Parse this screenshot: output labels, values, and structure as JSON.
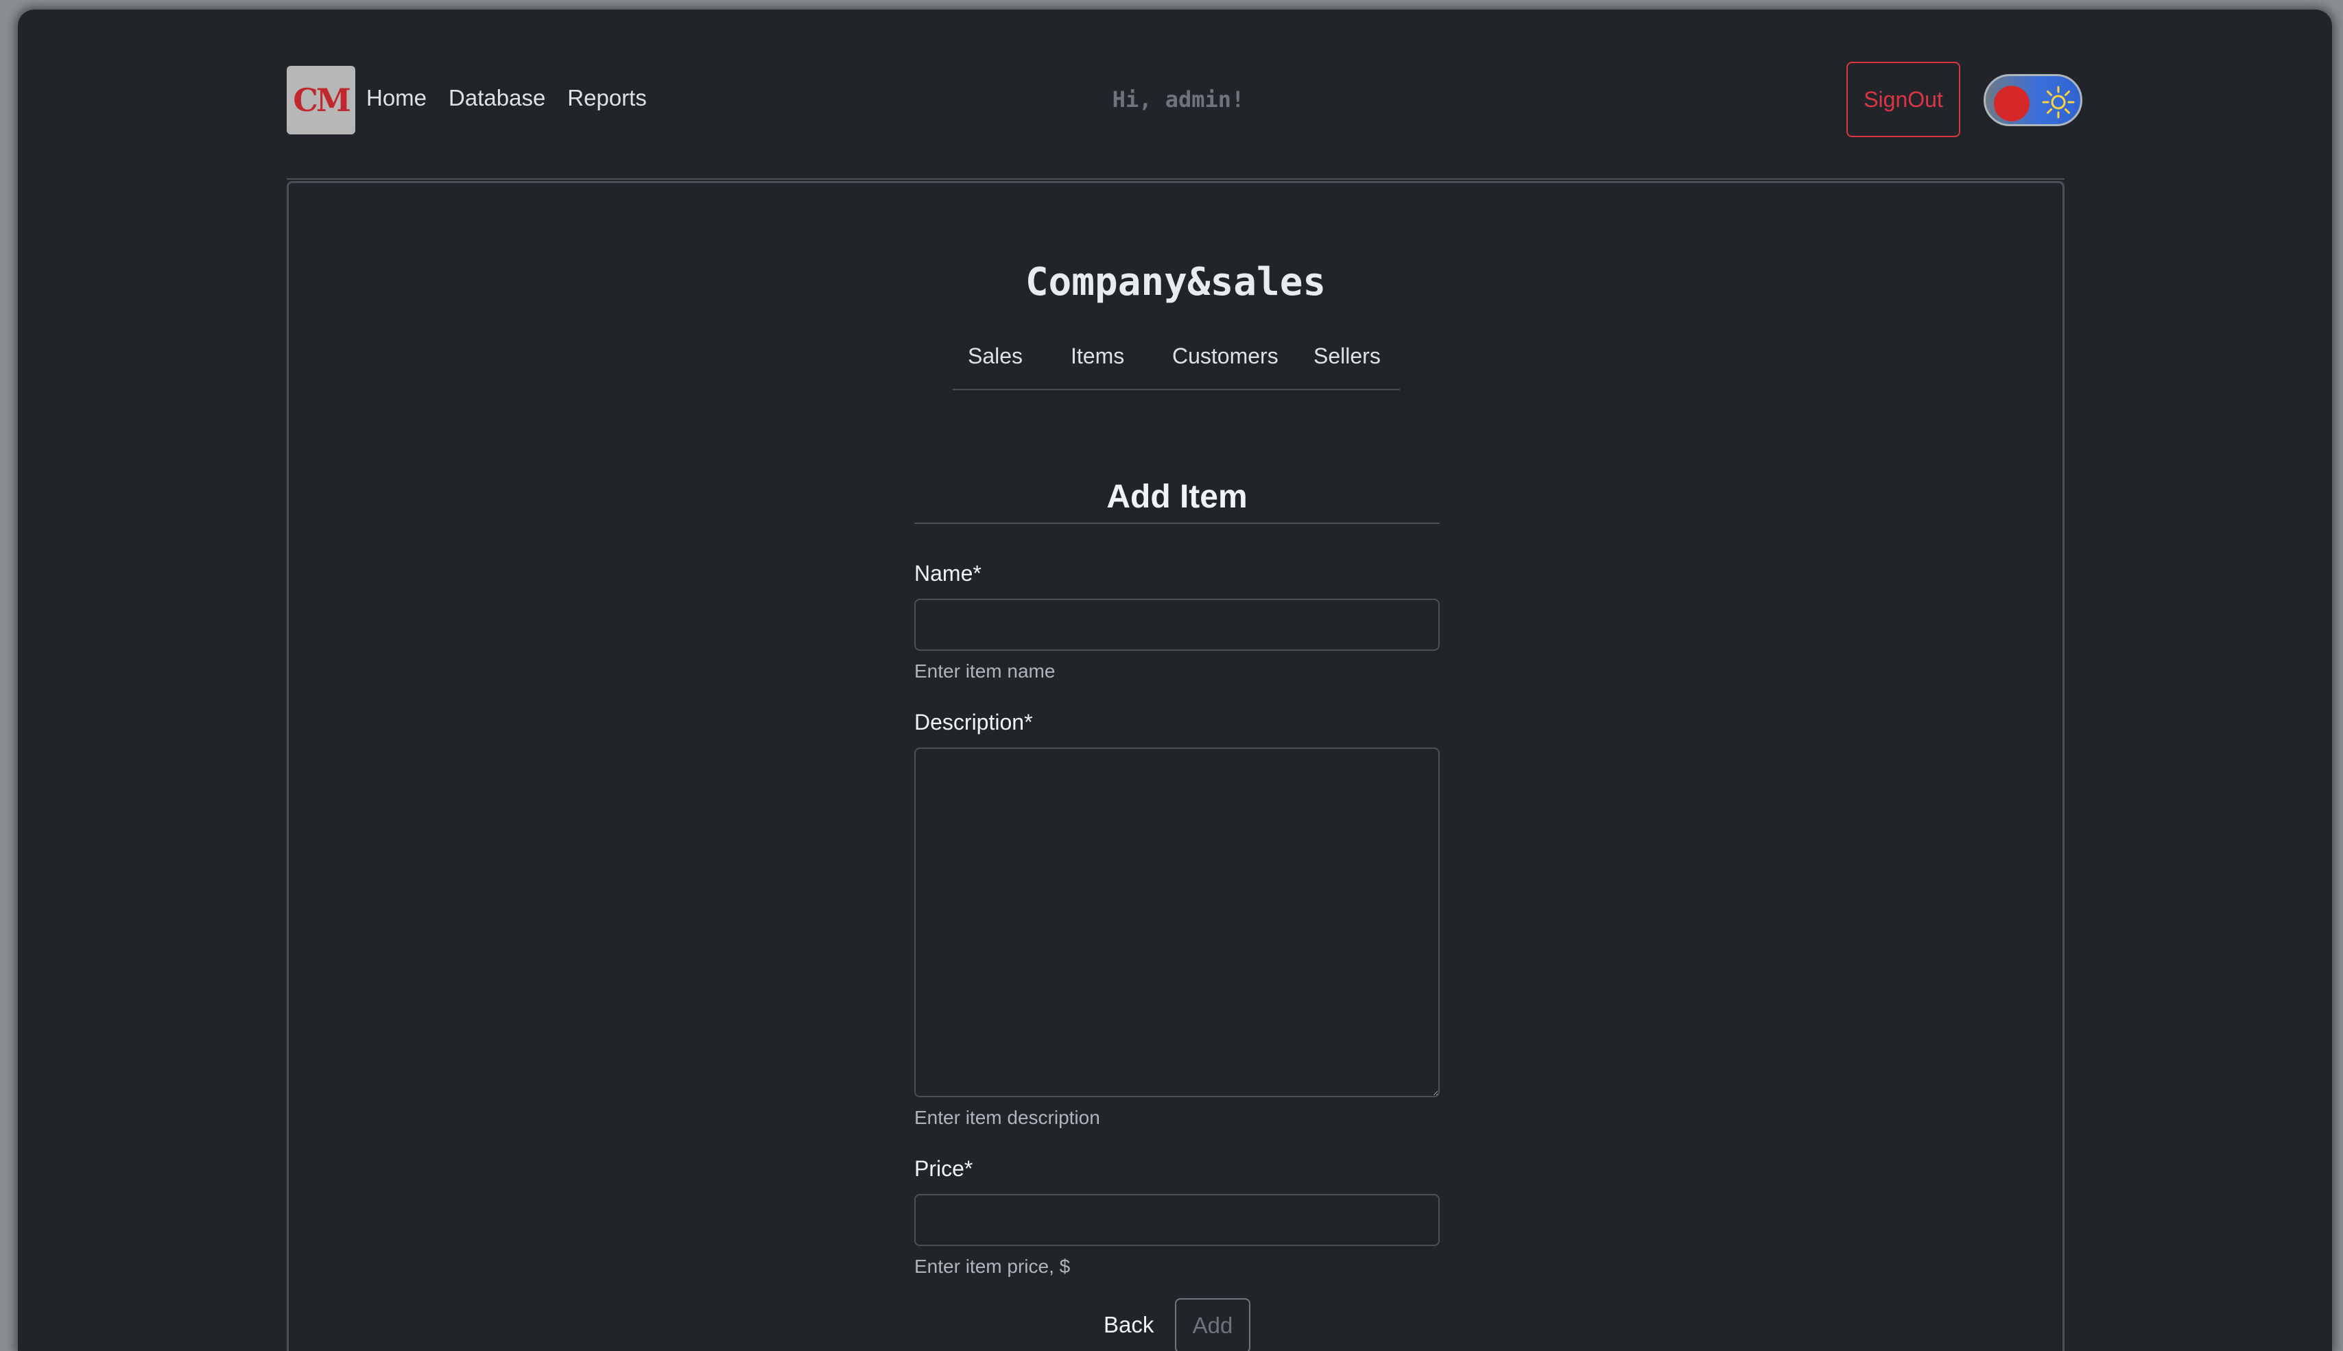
{
  "navbar": {
    "logo_text": "CM",
    "links": [
      "Home",
      "Database",
      "Reports"
    ],
    "greeting": "Hi, admin!",
    "signout_label": "SignOut",
    "theme_toggle": {
      "state": "dark",
      "knob_color": "#d62828",
      "icon": "sun-icon"
    }
  },
  "main": {
    "brand_title": "Company&sales",
    "subnav": [
      "Sales",
      "Items",
      "Customers",
      "Sellers"
    ]
  },
  "form": {
    "title": "Add Item",
    "name": {
      "label": "Name*",
      "value": "",
      "help": "Enter item name"
    },
    "description": {
      "label": "Description*",
      "value": "",
      "help": "Enter item description"
    },
    "price": {
      "label": "Price*",
      "value": "",
      "help": "Enter item price, $"
    },
    "back_label": "Back",
    "add_label": "Add"
  },
  "colors": {
    "background": "#212529",
    "danger": "#dc3545",
    "border": "#495057",
    "muted": "#6c757d"
  }
}
